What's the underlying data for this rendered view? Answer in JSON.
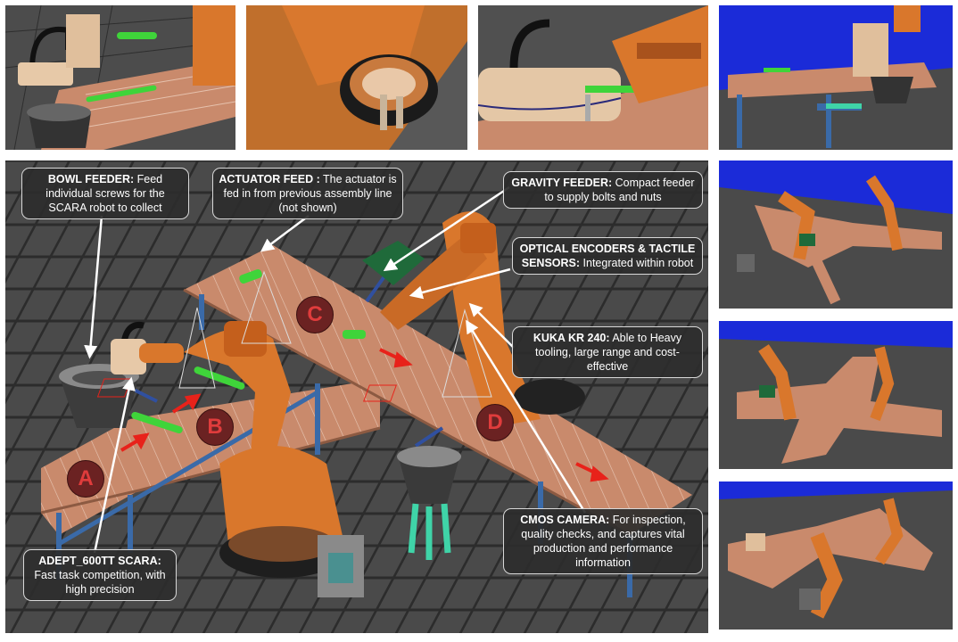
{
  "callouts": {
    "bowl_feeder": {
      "title": "BOWL FEEDER:",
      "text": "Feed individual screws for the SCARA robot to collect"
    },
    "actuator_feed": {
      "title": "ACTUATOR FEED :",
      "text": "The actuator is fed in from previous assembly line (not shown)"
    },
    "gravity_feeder": {
      "title": "GRAVITY FEEDER:",
      "text": "Compact feeder to supply bolts and nuts"
    },
    "optical_encoders": {
      "title": "OPTICAL ENCODERS & TACTILE SENSORS:",
      "text": "Integrated within robot"
    },
    "kuka": {
      "title": "KUKA KR 240:",
      "text": "Able to Heavy tooling, large range and cost-effective"
    },
    "adept": {
      "title": "ADEPT_600TT SCARA:",
      "text": "Fast task competition, with high precision"
    },
    "cmos": {
      "title": "CMOS CAMERA:",
      "text": "For inspection, quality checks, and captures vital production and performance information"
    }
  },
  "markers": [
    "A",
    "B",
    "C",
    "D"
  ],
  "colors": {
    "floor": "#4a4a4a",
    "grid": "#2c2c2c",
    "conveyor": "#c98a6c",
    "robot": "#d9772c",
    "frame": "#3a6aa8",
    "sky": "#1b2bd8",
    "marker": "#6b2222",
    "arrow_red": "#e8221a",
    "part_green": "#3fd43a"
  }
}
